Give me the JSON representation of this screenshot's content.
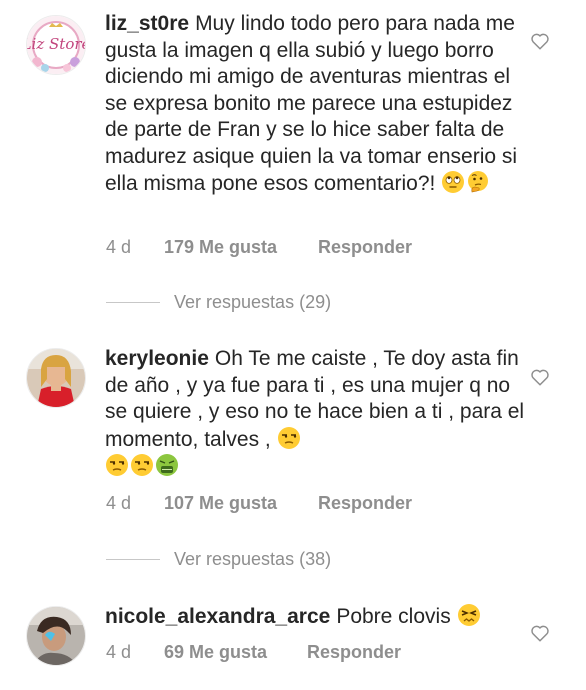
{
  "comments": [
    {
      "username": "liz_st0re",
      "text": "Muy lindo todo pero para nada me gusta la imagen q ella subió y luego borro diciendo  mi amigo de aventuras mientras el se expresa bonito me parece una estupidez  de parte de Fran y se lo hice saber falta de madurez asique quien la va tomar enserio si ella misma pone esos comentario?!",
      "emojis": [
        "eye-roll-emoji",
        "thinking-emoji"
      ],
      "time": "4 d",
      "likes": "179 Me gusta",
      "reply": "Responder",
      "view_replies": "Ver respuestas (29)",
      "avatar_text": "Liz Store"
    },
    {
      "username": "keryleonie",
      "text": "Oh Te me caiste , Te doy asta fin de año , y ya fue para ti , es una mujer q no se quiere , y eso no te hace bien a ti , para el momento, talves ,",
      "emojis": [
        "unamused-emoji",
        "unamused-emoji",
        "unamused-emoji",
        "nauseated-emoji"
      ],
      "time": "4 d",
      "likes": "107 Me gusta",
      "reply": "Responder",
      "view_replies": "Ver respuestas (38)"
    },
    {
      "username": "nicole_alexandra_arce",
      "text": "Pobre clovis",
      "emojis": [
        "persevering-emoji"
      ],
      "time": "4 d",
      "likes": "69 Me gusta",
      "reply": "Responder"
    }
  ]
}
